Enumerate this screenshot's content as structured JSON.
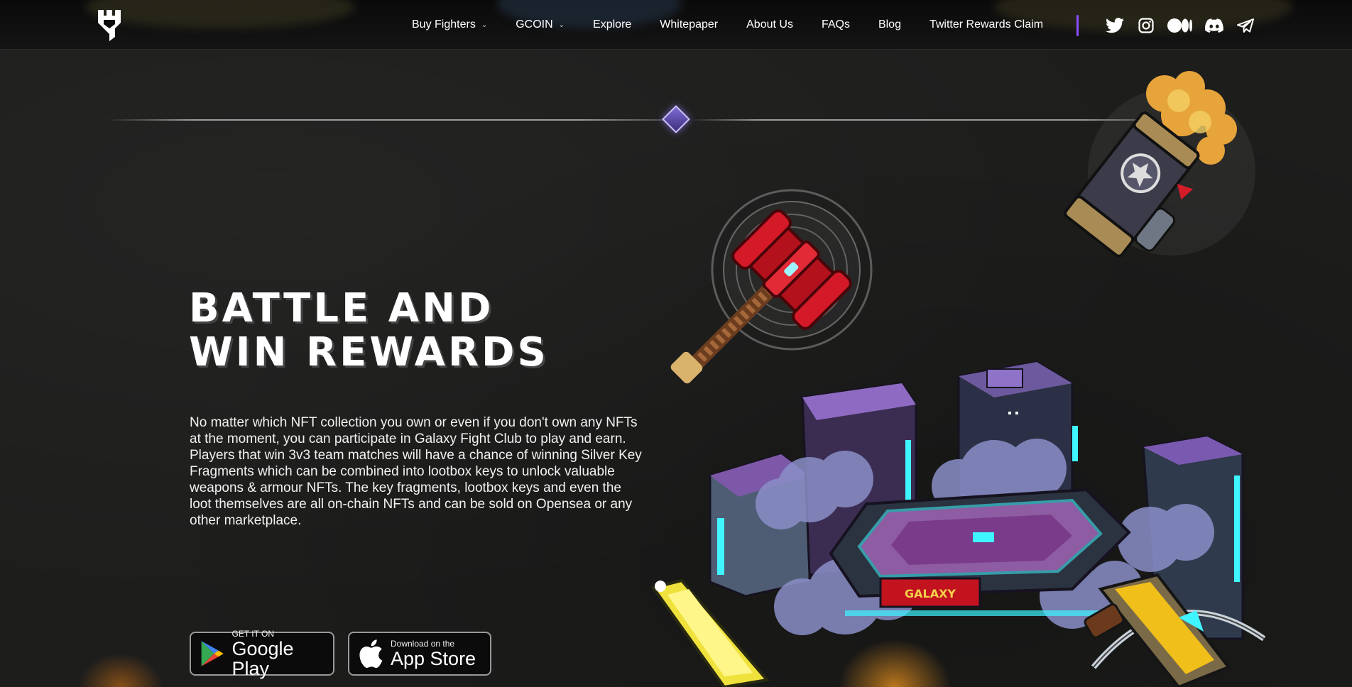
{
  "nav": {
    "items": [
      {
        "label": "Buy Fighters",
        "dropdown": true
      },
      {
        "label": "GCOIN",
        "dropdown": true
      },
      {
        "label": "Explore",
        "dropdown": false
      },
      {
        "label": "Whitepaper",
        "dropdown": false
      },
      {
        "label": "About Us",
        "dropdown": false
      },
      {
        "label": "FAQs",
        "dropdown": false
      },
      {
        "label": "Blog",
        "dropdown": false
      },
      {
        "label": "Twitter Rewards Claim",
        "dropdown": false
      }
    ],
    "social": [
      "twitter-icon",
      "instagram-icon",
      "medium-icon",
      "discord-icon",
      "telegram-icon"
    ],
    "accent": "#8a4cff"
  },
  "hero": {
    "headline_line1": "BATTLE AND",
    "headline_line2": "WIN REWARDS",
    "body": "No matter which NFT collection you own or even if you don't own any NFTs at the moment, you can participate in Galaxy Fight Club to play and earn. Players that win 3v3 team matches will have a chance of winning Silver Key Fragments which can be combined into lootbox keys to unlock valuable weapons & armour NFTs. The key fragments, lootbox keys and even the loot themselves are all on-chain NFTs and can be sold on Opensea or any other marketplace."
  },
  "stores": {
    "google": {
      "small": "GET IT ON",
      "big": "Google Play"
    },
    "apple": {
      "small": "Download on the",
      "big": "App Store"
    }
  },
  "art": {
    "arena_sign": "GALAXY"
  }
}
